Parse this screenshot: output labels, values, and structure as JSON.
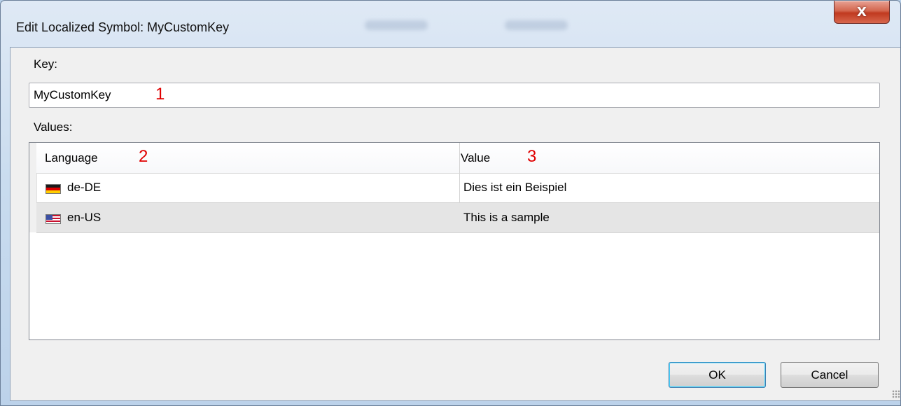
{
  "window": {
    "title": "Edit Localized Symbol: MyCustomKey",
    "close_glyph": "X"
  },
  "form": {
    "key_label": "Key:",
    "key_value": "MyCustomKey",
    "values_label": "Values:"
  },
  "markers": {
    "one": "1",
    "two": "2",
    "three": "3"
  },
  "grid": {
    "columns": [
      "Language",
      "Value"
    ],
    "rows": [
      {
        "flag": "flag-de-icon",
        "language": "de-DE",
        "value": "Dies ist ein Beispiel",
        "selected": false
      },
      {
        "flag": "flag-us-icon",
        "language": "en-US",
        "value": "This is a sample",
        "selected": true
      }
    ]
  },
  "buttons": {
    "ok": "OK",
    "cancel": "Cancel"
  },
  "colors": {
    "close_button": "#c0391f",
    "marker": "#e00000",
    "selected_row": "#e5e5e5"
  }
}
